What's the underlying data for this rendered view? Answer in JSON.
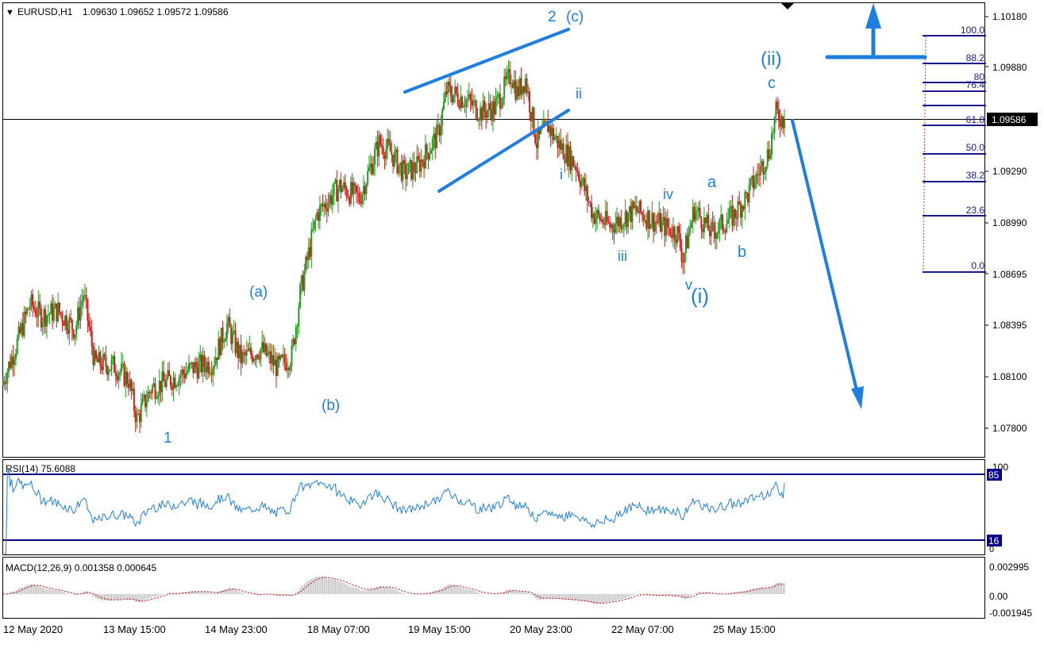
{
  "main_header": {
    "marker": "▼",
    "symbol": "EURUSD,H1",
    "ohlc": "1.09630 1.09652 1.09572 1.09586"
  },
  "price_axis": {
    "ticks": [
      "1.10180",
      "1.09880",
      "1.09290",
      "1.08990",
      "1.08695",
      "1.08395",
      "1.08100",
      "1.07800"
    ],
    "current_price_label": "1.09586"
  },
  "time_axis": {
    "labels": [
      "12 May 2020",
      "13 May 15:00",
      "14 May 23:00",
      "18 May 07:00",
      "19 May 15:00",
      "20 May 23:00",
      "22 May 07:00",
      "25 May 15:00"
    ]
  },
  "wave_labels": {
    "w1": "1",
    "wa": "(a)",
    "wb": "(b)",
    "w2": "2",
    "wc": "(c)",
    "wii_small": "ii",
    "wi_small": "i",
    "wiii": "iii",
    "wiv": "iv",
    "wv": "v",
    "wi_paren": "(i)",
    "wa_small": "a",
    "wb_small": "b",
    "wc_small": "c",
    "wii_paren": "(ii)"
  },
  "fibonacci": {
    "levels": [
      "100.0",
      "88.2",
      "80",
      "76.4",
      "61.8",
      "50.0",
      "38.2",
      "23.6",
      "0.0"
    ]
  },
  "rsi_panel": {
    "title": "RSI(14) 75.6088",
    "axis_max": "100",
    "axis_min": "0",
    "upper_level": "85",
    "lower_level": "16"
  },
  "macd_panel": {
    "title": "MACD(12,26,9) 0.001358 0.000645",
    "tick_top": "0.002995",
    "tick_mid": "0.00",
    "tick_bottom": "-0.001945"
  },
  "colors": {
    "bull": "#1e9e1e",
    "bear": "#d21b1b",
    "annotation_blue": "#1e7fe0",
    "fib_navy": "#1a1a8c",
    "rsi_line": "#1e7fe0",
    "level_navy": "#00008b"
  },
  "chart_data": {
    "type": "candlestick",
    "symbol": "EURUSD",
    "timeframe": "H1",
    "ylim": [
      1.0765,
      1.103
    ],
    "last_price": 1.09586,
    "price_path": [
      [
        0,
        1.0805
      ],
      [
        12,
        1.0832
      ],
      [
        20,
        1.0852
      ],
      [
        28,
        1.0845
      ],
      [
        40,
        1.0848
      ],
      [
        52,
        1.0837
      ],
      [
        58,
        1.0858
      ],
      [
        66,
        1.0818
      ],
      [
        80,
        1.0816
      ],
      [
        90,
        1.0808
      ],
      [
        96,
        1.0785
      ],
      [
        106,
        1.0803
      ],
      [
        120,
        1.0808
      ],
      [
        136,
        1.0815
      ],
      [
        150,
        1.0818
      ],
      [
        160,
        1.084
      ],
      [
        170,
        1.082
      ],
      [
        184,
        1.0826
      ],
      [
        196,
        1.0815
      ],
      [
        206,
        1.0822
      ],
      [
        212,
        1.0858
      ],
      [
        224,
        1.0904
      ],
      [
        240,
        1.092
      ],
      [
        254,
        1.0913
      ],
      [
        268,
        1.0945
      ],
      [
        276,
        1.094
      ],
      [
        286,
        1.0927
      ],
      [
        296,
        1.0932
      ],
      [
        310,
        1.095
      ],
      [
        316,
        1.0975
      ],
      [
        330,
        1.097
      ],
      [
        340,
        1.0963
      ],
      [
        350,
        1.0965
      ],
      [
        362,
        1.0985
      ],
      [
        366,
        1.0974
      ],
      [
        372,
        1.0982
      ],
      [
        380,
        1.0945
      ],
      [
        388,
        1.0955
      ],
      [
        396,
        1.0944
      ],
      [
        408,
        1.0932
      ],
      [
        420,
        1.0904
      ],
      [
        432,
        1.0897
      ],
      [
        450,
        1.0906
      ],
      [
        470,
        1.0897
      ],
      [
        480,
        1.0893
      ],
      [
        484,
        1.0878
      ],
      [
        492,
        1.0907
      ],
      [
        504,
        1.0893
      ],
      [
        520,
        1.0903
      ],
      [
        530,
        1.0915
      ],
      [
        545,
        1.094
      ],
      [
        550,
        1.0962
      ],
      [
        556,
        1.0958
      ]
    ],
    "candle_count": 556,
    "rsi": {
      "period": 14,
      "last": 75.6088,
      "levels": [
        85,
        16
      ],
      "range": [
        0,
        100
      ]
    },
    "macd": {
      "fast": 12,
      "slow": 26,
      "signal": 9,
      "macd_last": 0.001358,
      "signal_last": 0.000645,
      "range": [
        -0.001945,
        0.002995
      ]
    },
    "fibonacci_levels": [
      100.0,
      88.2,
      80,
      76.4,
      61.8,
      50.0,
      38.2,
      23.6,
      0.0
    ]
  }
}
